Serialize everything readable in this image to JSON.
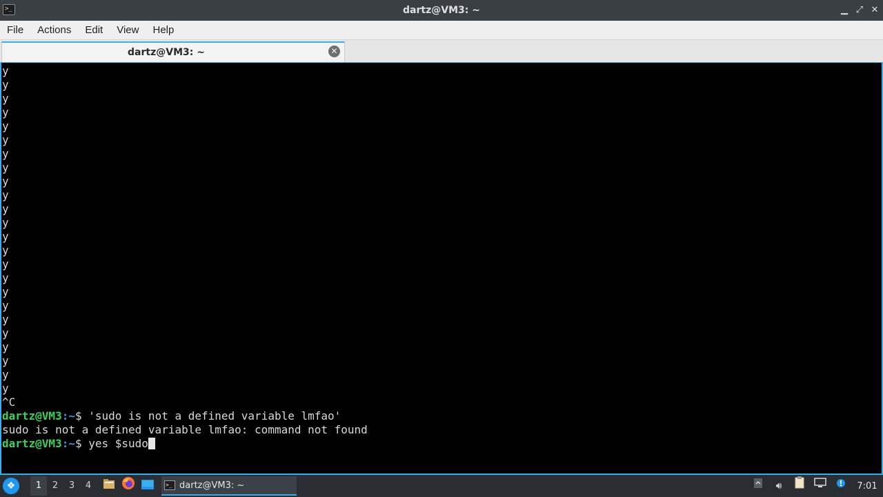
{
  "window": {
    "title": "dartz@VM3: ~",
    "controls": [
      "minimize-icon",
      "maximize-icon",
      "close-icon"
    ]
  },
  "menubar": {
    "items": [
      "File",
      "Actions",
      "Edit",
      "View",
      "Help"
    ]
  },
  "tabs": [
    {
      "label": "dartz@VM3: ~",
      "active": true
    }
  ],
  "terminal": {
    "output_lines": [
      "y",
      "y",
      "y",
      "y",
      "y",
      "y",
      "y",
      "y",
      "y",
      "y",
      "y",
      "y",
      "y",
      "y",
      "y",
      "y",
      "y",
      "y",
      "y",
      "y",
      "y",
      "y",
      "y",
      "y",
      "^C"
    ],
    "prompt_user_host": "dartz@VM3",
    "prompt_path_sep": ":~",
    "prompt_symbol": "$ ",
    "commands": [
      {
        "input": "'sudo is not a defined variable lmfao'",
        "output": "sudo is not a defined variable lmfao: command not found"
      }
    ],
    "current_input": "yes $sudo",
    "colors": {
      "prompt_user": "#3bd15b",
      "prompt_path": "#4a8fe0",
      "text": "#d8d8d8",
      "background": "#000000"
    }
  },
  "taskbar": {
    "start_icon": "kde-start-icon",
    "desktops": [
      "1",
      "2",
      "3",
      "4"
    ],
    "active_desktop": "1",
    "launchers": [
      "file-manager-icon",
      "firefox-icon",
      "show-desktop-icon"
    ],
    "window_task": {
      "label": "dartz@VM3: ~",
      "icon": "terminal-icon"
    },
    "tray_icons": [
      "tray-expand-icon",
      "volume-icon",
      "clipboard-icon",
      "network-icon",
      "notification-icon"
    ],
    "clock": "7:01"
  },
  "accent_color": "#3daee9"
}
